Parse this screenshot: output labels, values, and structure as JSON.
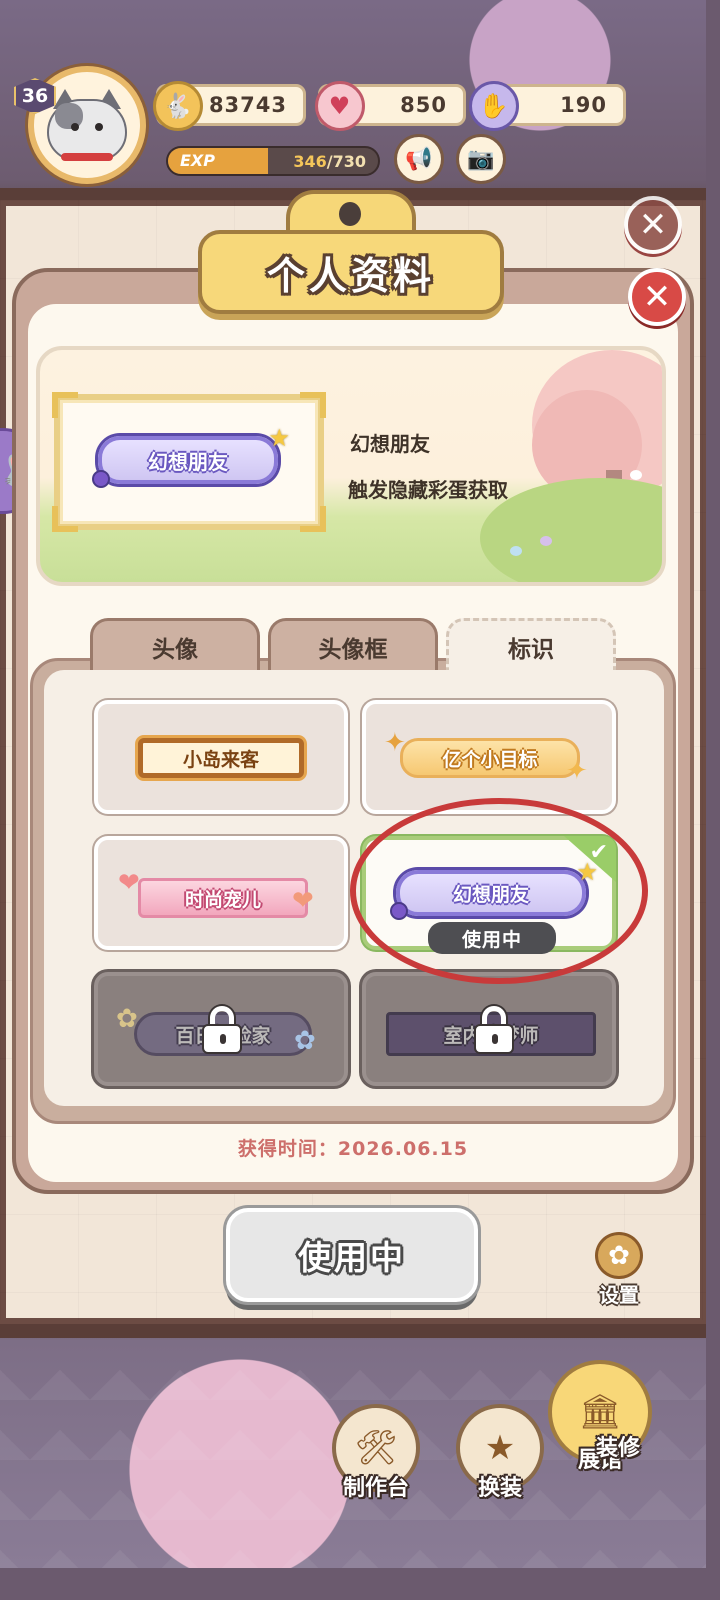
{
  "hud": {
    "level": "36",
    "coins": "83743",
    "hearts": "850",
    "energy": "190",
    "exp_label": "EXP",
    "exp_current": "346",
    "exp_max": "/730",
    "exp_fraction": 0.474
  },
  "modal": {
    "title": "个人资料",
    "preview": {
      "badge_text": "幻想朋友",
      "name": "幻想朋友",
      "description": "触发隐藏彩蛋获取"
    },
    "tabs": [
      "头像",
      "头像框",
      "标识"
    ],
    "active_tab": "标识",
    "badges": [
      {
        "label": "小岛来客",
        "state": "owned"
      },
      {
        "label": "亿个小目标",
        "state": "owned"
      },
      {
        "label": "时尚宠儿",
        "state": "owned"
      },
      {
        "label": "幻想朋友",
        "state": "in-use"
      },
      {
        "label": "百日探险家",
        "state": "locked"
      },
      {
        "label": "室内造梦师",
        "state": "locked"
      }
    ],
    "in_use_pill": "使用中",
    "obtain_time": "获得时间：2026.06.15",
    "use_button": "使用中"
  },
  "toolbar": {
    "settings": "设置",
    "craft": "制作台",
    "outfit": "换装",
    "museum": "展馆",
    "decor": "装修"
  },
  "icons": {
    "close": "close-icon",
    "coin": "rabbit-coin-icon",
    "heart": "heart-icon",
    "energy": "energy-glove-icon",
    "announce": "megaphone-icon",
    "camera": "camera-icon",
    "lock": "lock-icon",
    "check": "check-icon"
  },
  "colors": {
    "close_red": "#d84a46",
    "in_use_green": "#9acd68",
    "obtain_time": "#cd6f6b",
    "highlight_circle": "#c83a3a"
  }
}
